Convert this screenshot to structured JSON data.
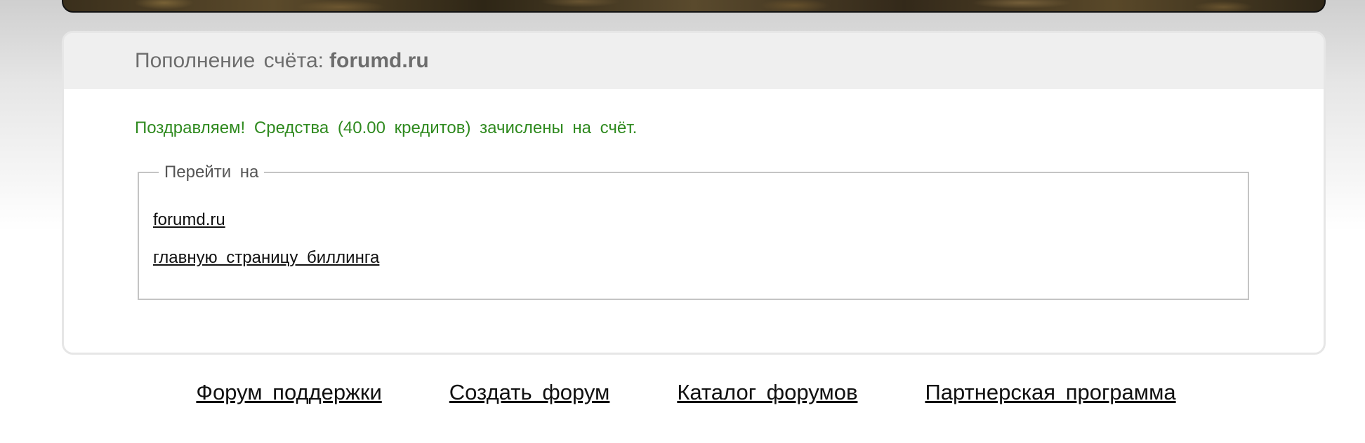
{
  "panel": {
    "title_prefix": "Пополнение счёта:",
    "site_name": "forumd.ru",
    "success_message": "Поздравляем! Средства (40.00 кредитов) зачислены на счёт."
  },
  "goto": {
    "legend": "Перейти на",
    "links": [
      {
        "label": "forumd.ru"
      },
      {
        "label": "главную страницу биллинга"
      }
    ]
  },
  "footer": {
    "links": [
      {
        "label": "Форум поддержки"
      },
      {
        "label": "Создать форум"
      },
      {
        "label": "Каталог форумов"
      },
      {
        "label": "Партнерская программа"
      }
    ]
  },
  "colors": {
    "success_text": "#2f8a1f",
    "title_text": "#6d6d6d",
    "panel_header_bg": "#efefef",
    "link_text": "#111111"
  }
}
